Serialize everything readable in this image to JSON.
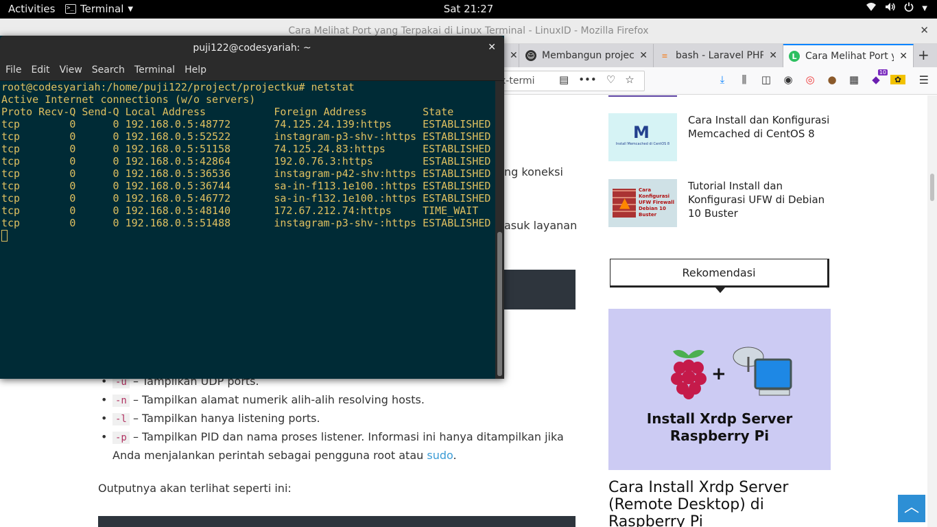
{
  "topbar": {
    "activities": "Activities",
    "app_name": "Terminal",
    "clock": "Sat 21:27"
  },
  "firefox": {
    "window_title": "Cara Melihat Port yang Terpakai di Linux Terminal - LinuxID - Mozilla Firefox",
    "tabs": [
      {
        "label": "",
        "active": false
      },
      {
        "label": "Membangun project",
        "active": false
      },
      {
        "label": "bash - Laravel PHP C",
        "active": false
      },
      {
        "label": "Cara Melihat Port yan",
        "active": true
      }
    ],
    "url_fragment": "x-termi",
    "toolbar_badge": "10"
  },
  "terminal": {
    "title": "puji122@codesyariah: ~",
    "menu": [
      "File",
      "Edit",
      "View",
      "Search",
      "Terminal",
      "Help"
    ],
    "lines": [
      "root@codesyariah:/home/puji122/project/projectku# netstat",
      "Active Internet connections (w/o servers)",
      "Proto Recv-Q Send-Q Local Address           Foreign Address         State      ",
      "tcp        0      0 192.168.0.5:48772       74.125.24.139:https     ESTABLISHED",
      "tcp        0      0 192.168.0.5:52522       instagram-p3-shv-:https ESTABLISHED",
      "tcp        0      0 192.168.0.5:51158       74.125.24.83:https      ESTABLISHED",
      "tcp        0      0 192.168.0.5:42864       192.0.76.3:https        ESTABLISHED",
      "tcp        0      0 192.168.0.5:36536       instagram-p42-shv:https ESTABLISHED",
      "tcp        0      0 192.168.0.5:36744       sa-in-f113.1e100.:https ESTABLISHED",
      "tcp        0      0 192.168.0.5:46772       sa-in-f132.1e100.:https ESTABLISHED",
      "tcp        0      0 192.168.0.5:48140       172.67.212.74:https     TIME_WAIT  ",
      "tcp        0      0 192.168.0.5:51488       instagram-p3-shv-:https ESTABLISHED"
    ]
  },
  "article": {
    "fragment_1": "ng koneksi",
    "fragment_2": "asuk layanan",
    "bullets": [
      {
        "code": "-u",
        "text": " – Tampilkan UDP ports."
      },
      {
        "code": "-n",
        "text": " – Tampilkan alamat numerik alih-alih resolving hosts."
      },
      {
        "code": "-l",
        "text": " – Tampilkan hanya listening ports."
      },
      {
        "code": "-p",
        "text": " – Tampilkan PID dan nama proses listener. Informasi ini hanya ditampilkan jika Anda menjalankan perintah sebagai pengguna root atau ",
        "link": "sudo",
        "tail": "."
      }
    ],
    "output_intro": "Outputnya akan terlihat seperti ini:"
  },
  "sidebar": {
    "posts": [
      {
        "title": "Cara Install dan Konfigurasi Memcached di CentOS 8",
        "thumb_caption": "Install Memcached di CentOS 8"
      },
      {
        "title": "Tutorial Install dan Konfigurasi UFW di Debian 10 Buster",
        "thumb_caption": "Cara Konfigurasi UFW Firewall Debian 10 Buster"
      }
    ],
    "section_heading": "Rekomendasi",
    "feature_caption": "Install Xrdp Server Raspberry Pi",
    "feature_title": "Cara Install Xrdp Server (Remote Desktop) di Raspberry Pi"
  },
  "colors": {
    "terminal_bg": "#002b36",
    "terminal_fg": "#e0c060",
    "accent": "#0a84ff",
    "link": "#3a9bd5"
  }
}
